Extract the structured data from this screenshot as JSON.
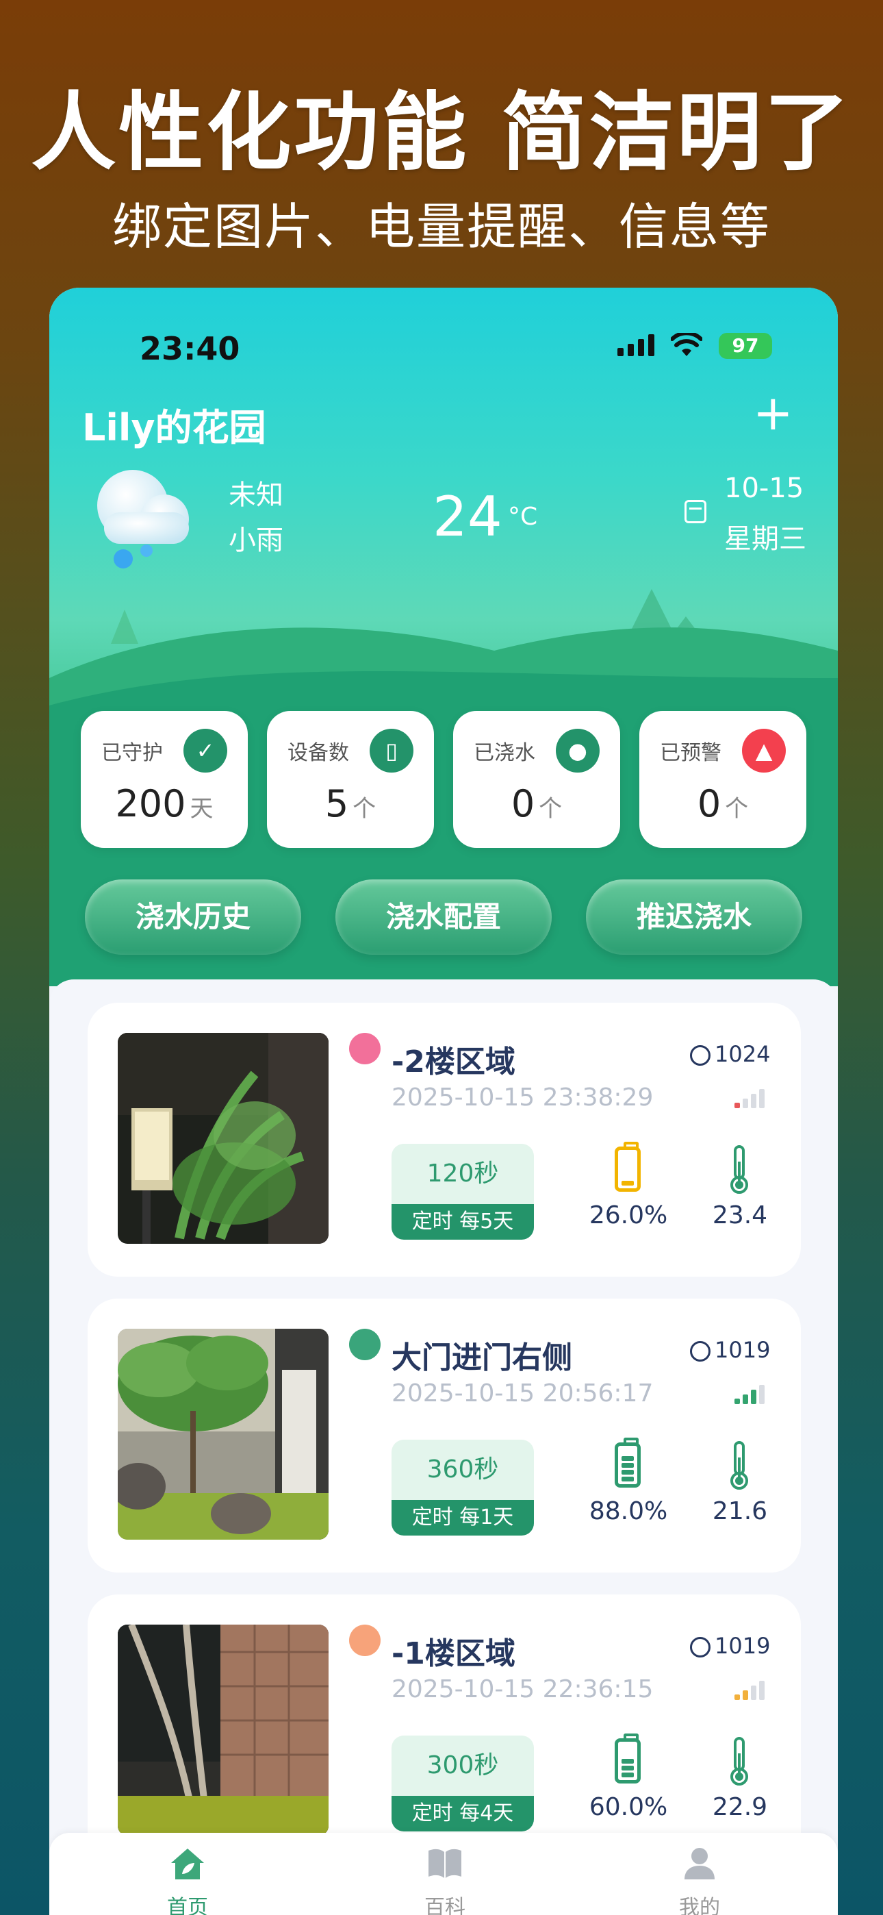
{
  "headline": "人性化功能 简洁明了",
  "subline": "绑定图片、电量提醒、信息等",
  "status": {
    "time": "23:40",
    "battery": "97"
  },
  "garden": {
    "title": "Lily的花园",
    "add_label": "+",
    "weather": {
      "line1": "未知",
      "line2": "小雨",
      "temp": "24",
      "unit": "°C",
      "date": "10-15",
      "weekday": "星期三"
    }
  },
  "stats": [
    {
      "label": "已守护",
      "value": "200",
      "unit": "天",
      "icon": "shield-check-icon"
    },
    {
      "label": "设备数",
      "value": "5",
      "unit": "个",
      "icon": "device-icon"
    },
    {
      "label": "已浇水",
      "value": "0",
      "unit": "个",
      "icon": "water-drop-icon"
    },
    {
      "label": "已预警",
      "value": "0",
      "unit": "个",
      "icon": "alarm-icon"
    }
  ],
  "actions": [
    "浇水历史",
    "浇水配置",
    "推迟浇水"
  ],
  "devices": [
    {
      "name": "-2楼区域",
      "timestamp": "2025-10-15 23:38:29",
      "id": "1024",
      "dot_color": "#f2709a",
      "duration": "120秒",
      "schedule": "定时 每5天",
      "battery": "26.0%",
      "battery_level": 0.26,
      "temperature": "23.4",
      "signal_color": "#e8585a",
      "signal_bars": 1
    },
    {
      "name": "大门进门右侧",
      "timestamp": "2025-10-15 20:56:17",
      "id": "1019",
      "dot_color": "#3aa57b",
      "duration": "360秒",
      "schedule": "定时 每1天",
      "battery": "88.0%",
      "battery_level": 0.88,
      "temperature": "21.6",
      "signal_color": "#34a46f",
      "signal_bars": 3
    },
    {
      "name": "-1楼区域",
      "timestamp": "2025-10-15 22:36:15",
      "id": "1019",
      "dot_color": "#f7a37a",
      "duration": "300秒",
      "schedule": "定时 每4天",
      "battery": "60.0%",
      "battery_level": 0.6,
      "temperature": "22.9",
      "signal_color": "#f2b03c",
      "signal_bars": 2
    }
  ],
  "tabs": [
    {
      "label": "首页",
      "icon": "home-leaf-icon"
    },
    {
      "label": "百科",
      "icon": "book-icon"
    },
    {
      "label": "我的",
      "icon": "user-icon"
    }
  ]
}
